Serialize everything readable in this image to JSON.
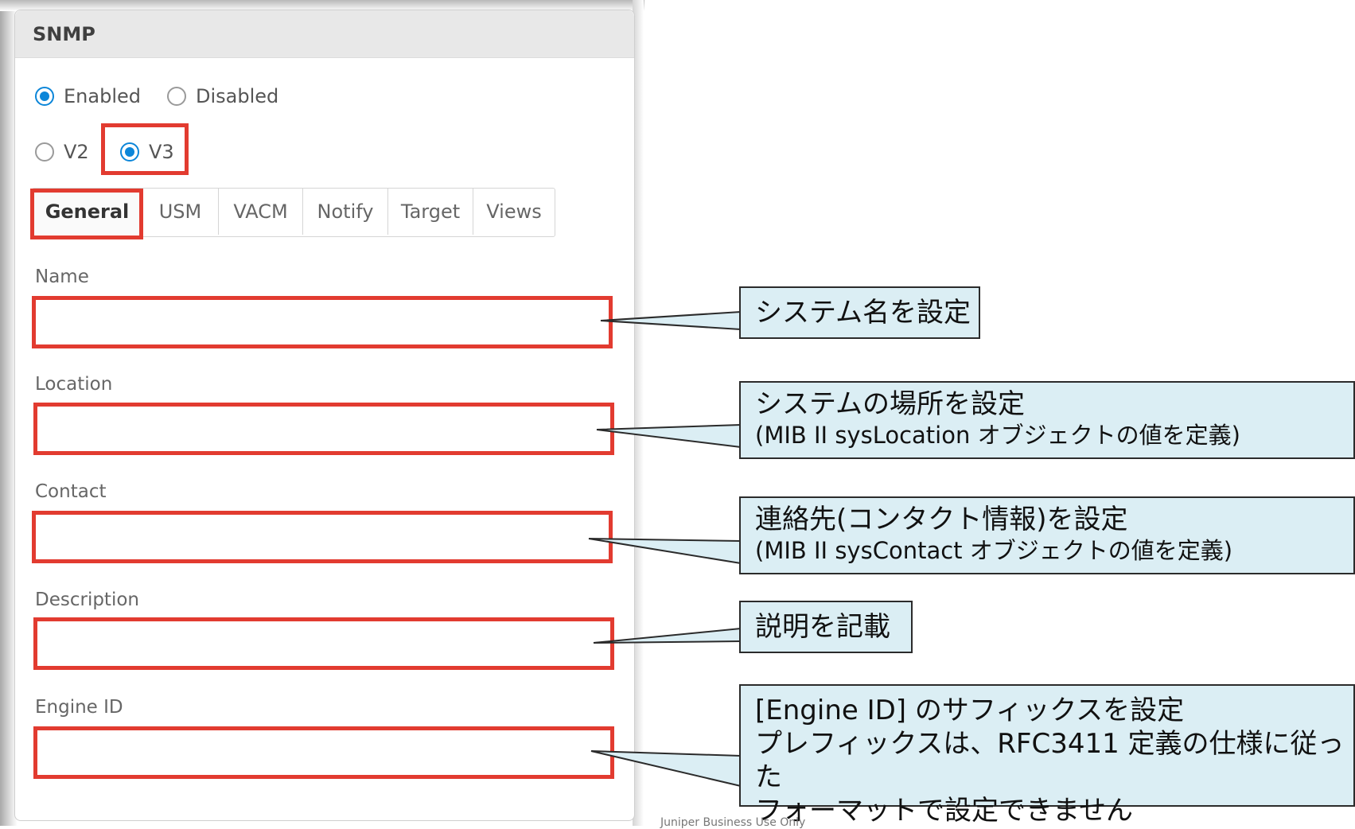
{
  "panel": {
    "title": "SNMP"
  },
  "status_radios": [
    {
      "label": "Enabled",
      "checked": true
    },
    {
      "label": "Disabled",
      "checked": false
    }
  ],
  "version_radios": [
    {
      "label": "V2",
      "checked": false
    },
    {
      "label": "V3",
      "checked": true
    }
  ],
  "tabs": [
    {
      "label": "General",
      "active": true
    },
    {
      "label": "USM"
    },
    {
      "label": "VACM"
    },
    {
      "label": "Notify"
    },
    {
      "label": "Target"
    },
    {
      "label": "Views"
    }
  ],
  "fields": {
    "name": {
      "label": "Name",
      "value": ""
    },
    "location": {
      "label": "Location",
      "value": ""
    },
    "contact": {
      "label": "Contact",
      "value": ""
    },
    "description": {
      "label": "Description",
      "value": ""
    },
    "engine_id": {
      "label": "Engine ID",
      "value": ""
    }
  },
  "callouts": {
    "name": {
      "main": "システム名を設定"
    },
    "location": {
      "main": "システムの場所を設定",
      "sub": "(MIB II sysLocation オブジェクトの値を定義)"
    },
    "contact": {
      "main": "連絡先(コンタクト情報)を設定",
      "sub": "(MIB II sysContact オブジェクトの値を定義)"
    },
    "description": {
      "main": "説明を記載"
    },
    "engine_id": {
      "line1": "[Engine ID] のサフィックスを設定",
      "line2": "プレフィックスは、RFC3411 定義の仕様に従った",
      "line3": "フォーマットで設定できません"
    }
  },
  "footer": "Juniper Business Use Only",
  "colors": {
    "highlight": "#e23b30",
    "callout_bg": "#dbeef4",
    "radio_accent": "#0c86d9",
    "header_bg": "#e8e8e8"
  }
}
